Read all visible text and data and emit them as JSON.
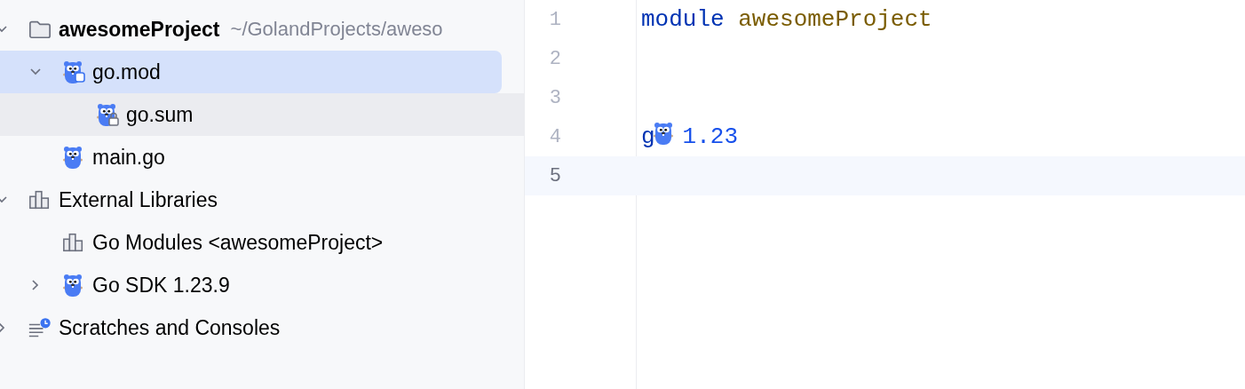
{
  "project_tree": {
    "items": [
      {
        "label": "awesomeProject",
        "path": "~/GolandProjects/aweso",
        "kind": "folder",
        "expanded": true,
        "selected": false,
        "hovered": false,
        "children": [
          {
            "label": "go.mod",
            "kind": "module",
            "expanded": true,
            "selected": true,
            "hovered": false,
            "children": [
              {
                "label": "go.sum",
                "kind": "locked",
                "selected": false,
                "hovered": true
              }
            ]
          },
          {
            "label": "main.go",
            "kind": "gofile",
            "selected": false,
            "hovered": false
          }
        ]
      },
      {
        "label": "External Libraries",
        "kind": "library",
        "expanded": true,
        "selected": false,
        "hovered": false,
        "children": [
          {
            "label": "Go Modules <awesomeProject>",
            "kind": "library",
            "selected": false,
            "hovered": false
          },
          {
            "label": "Go SDK 1.23.9",
            "kind": "gofile",
            "expanded": false,
            "selected": false,
            "hovered": false
          }
        ]
      },
      {
        "label": "Scratches and Consoles",
        "kind": "scratches",
        "expanded": false,
        "selected": false,
        "hovered": false
      }
    ]
  },
  "editor": {
    "lines": [
      {
        "number": "1",
        "current": false,
        "tokens": [
          {
            "kind": "keyword",
            "text": "module"
          },
          {
            "kind": "name",
            "text": "awesomeProject"
          }
        ]
      },
      {
        "number": "2",
        "current": false
      },
      {
        "number": "3",
        "current": false
      },
      {
        "number": "4",
        "current": false,
        "tokens": [
          {
            "kind": "keyword",
            "text": "g"
          },
          {
            "kind": "gopher"
          },
          {
            "kind": "version",
            "text": "1.23"
          }
        ]
      },
      {
        "number": "5",
        "current": true
      }
    ]
  }
}
